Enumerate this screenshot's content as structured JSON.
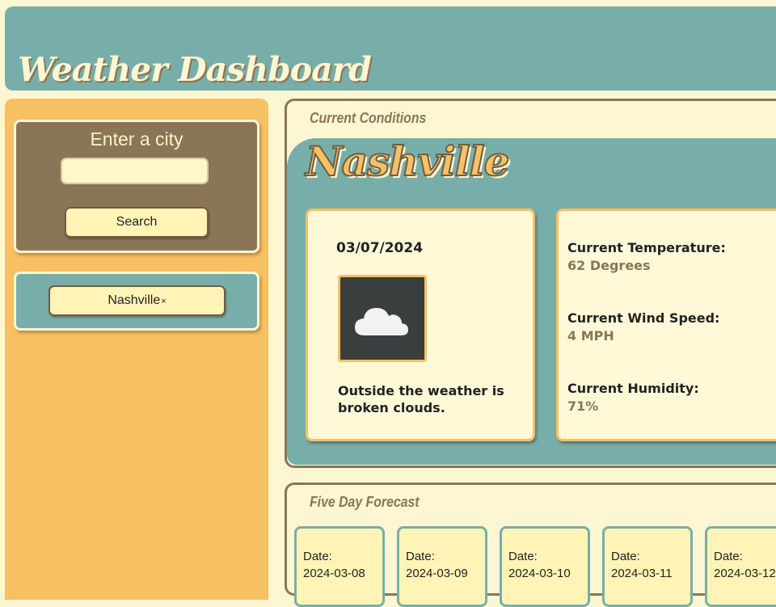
{
  "header": {
    "title": "Weather Dashboard"
  },
  "sidebar": {
    "search": {
      "label": "Enter a city",
      "input_value": "",
      "input_placeholder": "",
      "button_label": "Search"
    },
    "history": [
      {
        "city": "Nashville",
        "remove_symbol": "×"
      }
    ]
  },
  "current": {
    "section_title": "Current Conditions",
    "city": "Nashville",
    "date": "03/07/2024",
    "icon": "broken-clouds-icon",
    "description": "Outside the weather is broken clouds.",
    "temperature_label": "Current Temperature:",
    "temperature_value": "62 Degrees",
    "wind_label": "Current Wind Speed:",
    "wind_value": "4 MPH",
    "humidity_label": "Current Humidity:",
    "humidity_value": "71%"
  },
  "forecast": {
    "section_title": "Five Day Forecast",
    "days": [
      {
        "label": "Date:",
        "date": "2024-03-08"
      },
      {
        "label": "Date:",
        "date": "2024-03-09"
      },
      {
        "label": "Date:",
        "date": "2024-03-10"
      },
      {
        "label": "Date:",
        "date": "2024-03-11"
      },
      {
        "label": "Date:",
        "date": "2024-03-12"
      }
    ]
  },
  "colors": {
    "teal": "#78aeaa",
    "orange": "#f7c063",
    "brown": "#8a7656",
    "cream": "#fdf6d3",
    "button_yellow": "#fff4b5"
  }
}
